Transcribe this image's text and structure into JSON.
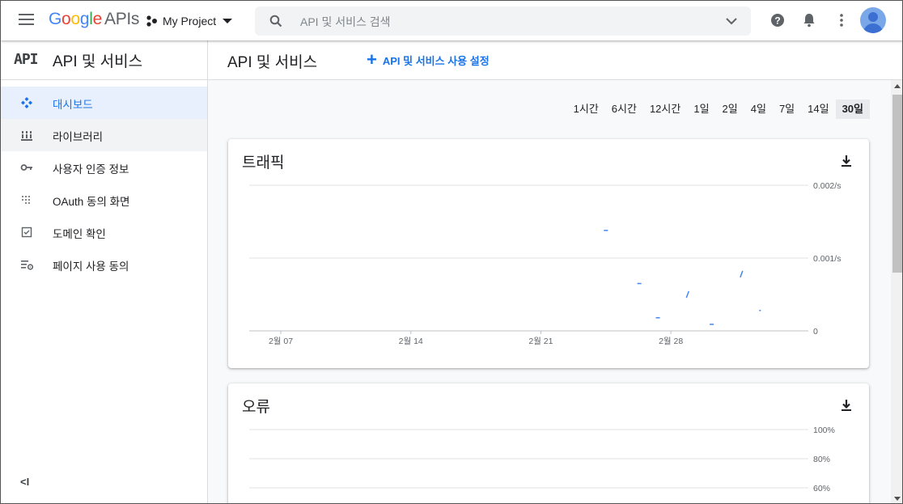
{
  "header": {
    "logo_google": [
      "G",
      "o",
      "o",
      "g",
      "l",
      "e"
    ],
    "logo_apis": "APIs",
    "project_name": "My Project",
    "search_placeholder": "API 및 서비스 검색"
  },
  "sidebar": {
    "brand_mark": "API",
    "title": "API 및 서비스",
    "items": [
      {
        "label": "대시보드",
        "icon": "dashboard-icon",
        "active": true
      },
      {
        "label": "라이브러리",
        "icon": "library-icon"
      },
      {
        "label": "사용자 인증 정보",
        "icon": "key-icon"
      },
      {
        "label": "OAuth 동의 화면",
        "icon": "oauth-dots-icon"
      },
      {
        "label": "도메인 확인",
        "icon": "checkbox-icon"
      },
      {
        "label": "페이지 사용 동의",
        "icon": "settings-list-icon"
      }
    ],
    "collapse_label": "<I"
  },
  "main": {
    "title": "API 및 서비스",
    "enable_button": "API 및 서비스 사용 설정",
    "time_ranges": [
      "1시간",
      "6시간",
      "12시간",
      "1일",
      "2일",
      "4일",
      "7일",
      "14일",
      "30일"
    ],
    "selected_range": "30일"
  },
  "colors": {
    "accent": "#1a73e8",
    "series": "#4285f4"
  },
  "chart_data": [
    {
      "type": "scatter",
      "title": "트래픽",
      "ylim": [
        0,
        0.002
      ],
      "y_ticks": [
        "0.002/s",
        "0.001/s",
        "0"
      ],
      "x_ticks": [
        "2월 07",
        "2월 14",
        "2월 21",
        "2월 28"
      ],
      "x_tick_days": [
        7,
        14,
        21,
        28
      ],
      "x_range_days": [
        5.3,
        35.4
      ],
      "grid": true,
      "points": [
        {
          "x": 24.5,
          "y": 0.00138,
          "kind": "dash"
        },
        {
          "x": 26.3,
          "y": 0.00065,
          "kind": "dash"
        },
        {
          "x": 27.3,
          "y": 0.00018,
          "kind": "dash"
        },
        {
          "x": 28.9,
          "y": 0.0005,
          "kind": "slash"
        },
        {
          "x": 30.2,
          "y": 9e-05,
          "kind": "dash"
        },
        {
          "x": 31.8,
          "y": 0.00078,
          "kind": "slash"
        },
        {
          "x": 32.8,
          "y": 0.00028,
          "kind": "dot"
        }
      ]
    },
    {
      "type": "line",
      "title": "오류",
      "y_ticks": [
        "100%",
        "80%",
        "60%"
      ],
      "grid": true
    }
  ]
}
